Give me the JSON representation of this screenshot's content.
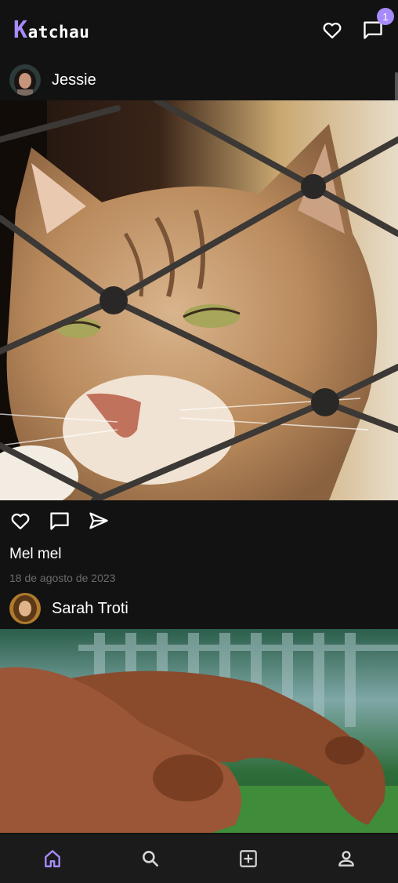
{
  "app": {
    "logo_first": "K",
    "logo_rest": "atchau",
    "accent_color": "#a78bfa",
    "background_color": "#121212"
  },
  "header": {
    "favorites_icon": "heart-icon",
    "messages_icon": "chat-bubble-icon",
    "messages_badge": "1"
  },
  "posts": [
    {
      "author": "Jessie",
      "image_subject": "cat-behind-net",
      "caption": "Mel mel",
      "date": "18 de agosto de 2023",
      "actions": [
        "heart-icon",
        "comment-icon",
        "send-icon"
      ]
    },
    {
      "author": "Sarah Troti",
      "image_subject": "two-dogs-grazing"
    }
  ],
  "bottom_nav": {
    "items": [
      {
        "name": "home",
        "icon": "home-icon",
        "active": true
      },
      {
        "name": "search",
        "icon": "search-icon",
        "active": false
      },
      {
        "name": "create",
        "icon": "add-box-icon",
        "active": false
      },
      {
        "name": "profile",
        "icon": "person-icon",
        "active": false
      }
    ]
  }
}
